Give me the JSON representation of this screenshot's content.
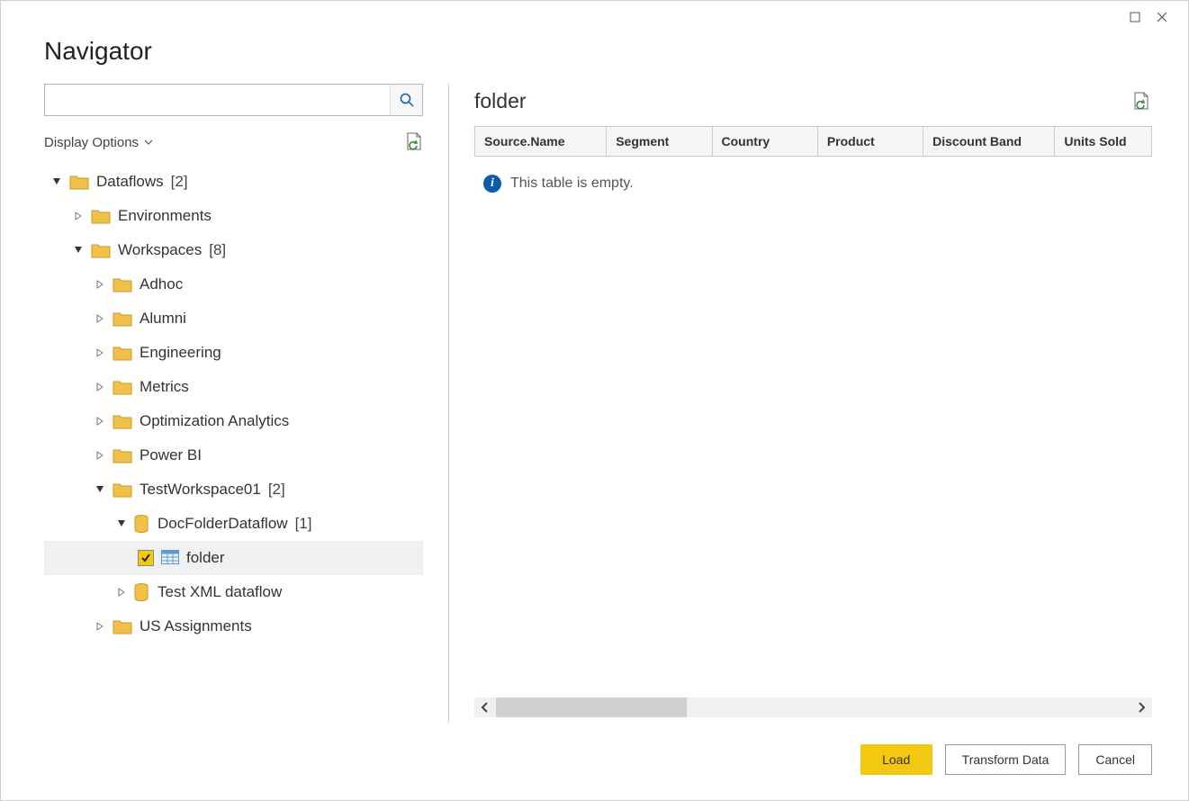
{
  "window": {
    "title": "Navigator"
  },
  "search": {
    "value": "",
    "placeholder": ""
  },
  "display_options": {
    "label": "Display Options"
  },
  "tree": {
    "root": {
      "label": "Dataflows",
      "count": "[2]"
    },
    "environments": {
      "label": "Environments"
    },
    "workspaces": {
      "label": "Workspaces",
      "count": "[8]"
    },
    "adhoc": {
      "label": "Adhoc"
    },
    "alumni": {
      "label": "Alumni"
    },
    "engineering": {
      "label": "Engineering"
    },
    "metrics": {
      "label": "Metrics"
    },
    "optimization": {
      "label": "Optimization Analytics"
    },
    "powerbi": {
      "label": "Power BI"
    },
    "testws": {
      "label": "TestWorkspace01",
      "count": "[2]"
    },
    "docfolder": {
      "label": "DocFolderDataflow",
      "count": "[1]"
    },
    "folder_item": {
      "label": "folder"
    },
    "testxml": {
      "label": "Test XML dataflow"
    },
    "usassign": {
      "label": "US Assignments"
    }
  },
  "preview": {
    "title": "folder",
    "columns": [
      "Source.Name",
      "Segment",
      "Country",
      "Product",
      "Discount Band",
      "Units Sold"
    ],
    "empty_message": "This table is empty."
  },
  "buttons": {
    "load": "Load",
    "transform": "Transform Data",
    "cancel": "Cancel"
  }
}
